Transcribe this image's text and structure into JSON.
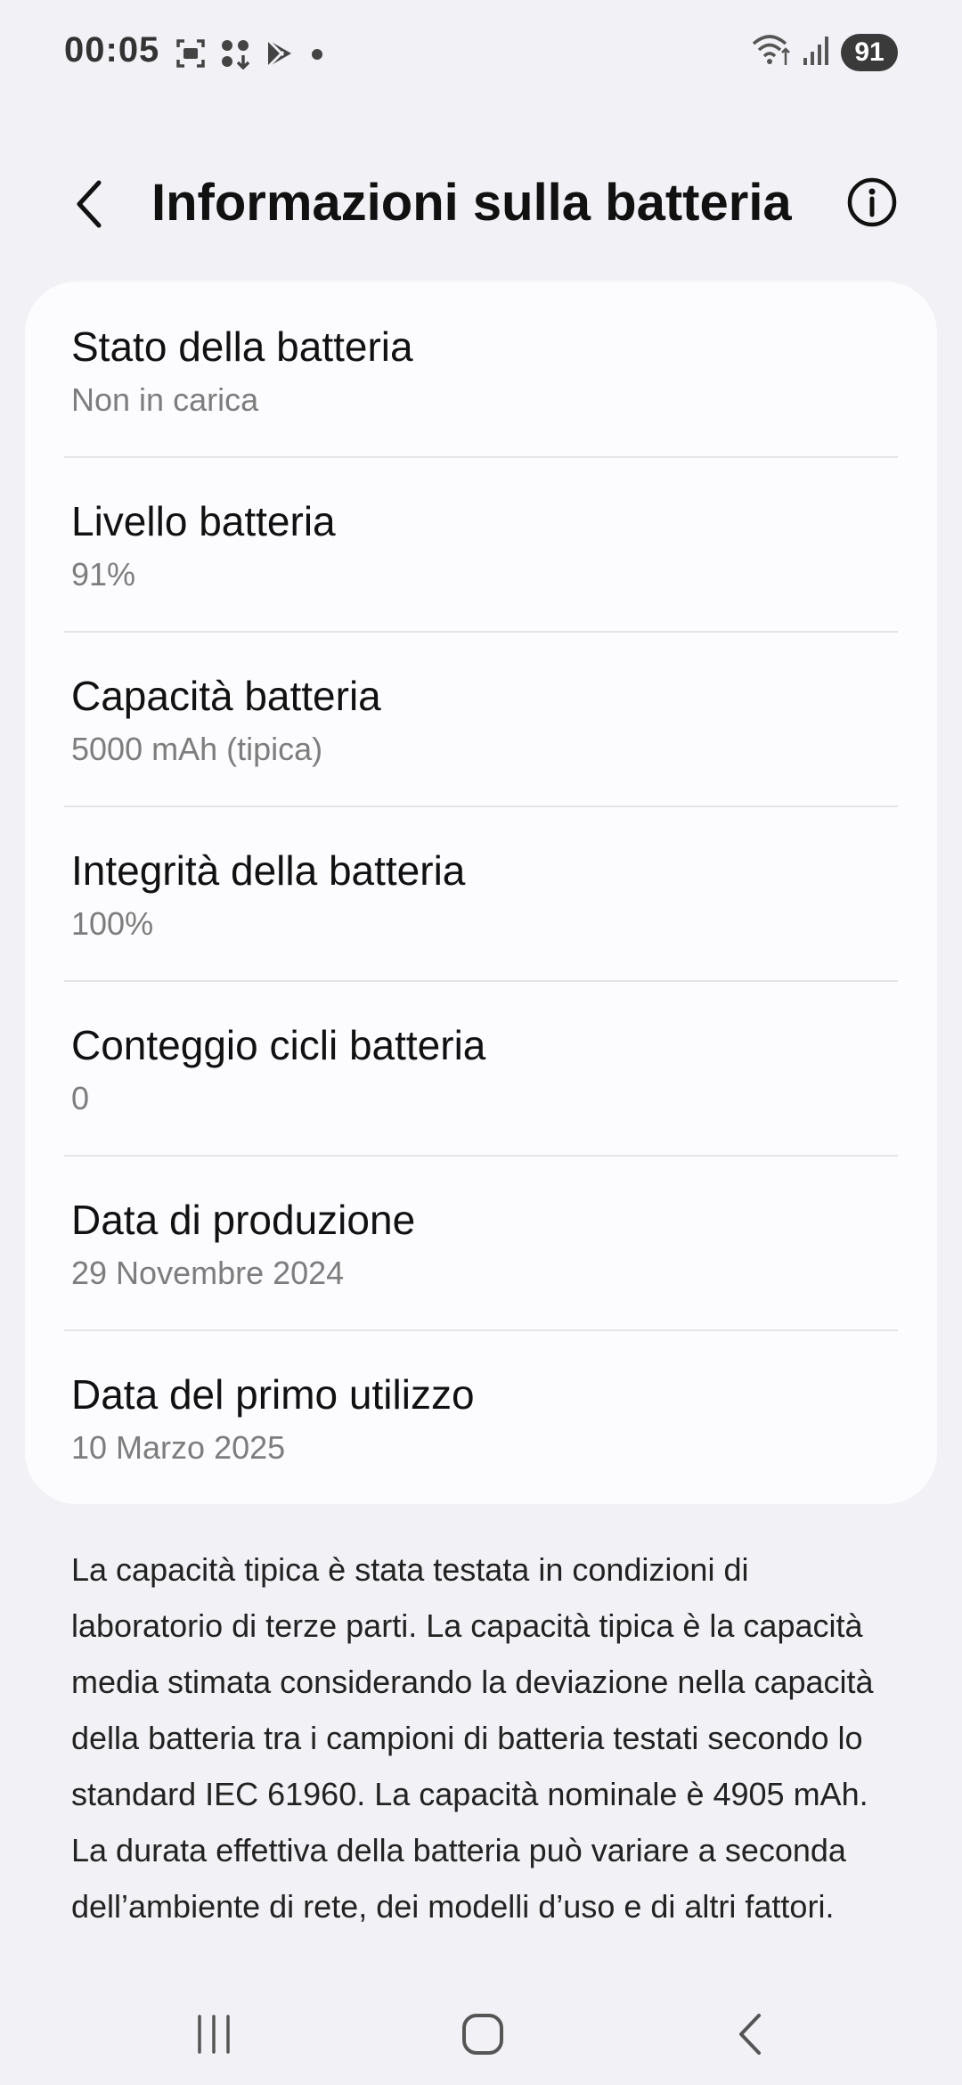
{
  "status_bar": {
    "time": "00:05",
    "battery_level": "91",
    "left_icons": [
      "screenshot-icon",
      "apps-icon",
      "play-store-icon",
      "dot-icon"
    ],
    "right_icons": [
      "wifi-icon",
      "signal-icon"
    ]
  },
  "header": {
    "title": "Informazioni sulla batteria",
    "back_icon": "back-chevron-icon",
    "info_icon": "info-icon"
  },
  "battery_info": {
    "items": [
      {
        "title": "Stato della batteria",
        "value": "Non in carica"
      },
      {
        "title": "Livello batteria",
        "value": "91%"
      },
      {
        "title": "Capacità batteria",
        "value": "5000 mAh (tipica)"
      },
      {
        "title": "Integrità della batteria",
        "value": "100%"
      },
      {
        "title": "Conteggio cicli batteria",
        "value": "0"
      },
      {
        "title": "Data di produzione",
        "value": "29 Novembre 2024"
      },
      {
        "title": "Data del primo utilizzo",
        "value": "10 Marzo 2025"
      }
    ]
  },
  "footnote": "La capacità tipica è stata testata in condizioni di laboratorio di terze parti. La capacità tipica è la capacità media stimata considerando la deviazione nella capacità della batteria tra i campioni di batteria testati secondo lo standard IEC 61960. La capacità nominale è 4905 mAh. La durata effettiva della batteria può variare a seconda dell’ambiente di rete, dei modelli d’uso e di altri fattori.",
  "nav_bar": {
    "buttons": [
      "recent-apps-icon",
      "home-icon",
      "back-icon"
    ]
  },
  "colors": {
    "background": "#f2f2f6",
    "card": "#fcfcfe",
    "title_text": "#111111",
    "secondary_text": "#7d7d7d"
  }
}
